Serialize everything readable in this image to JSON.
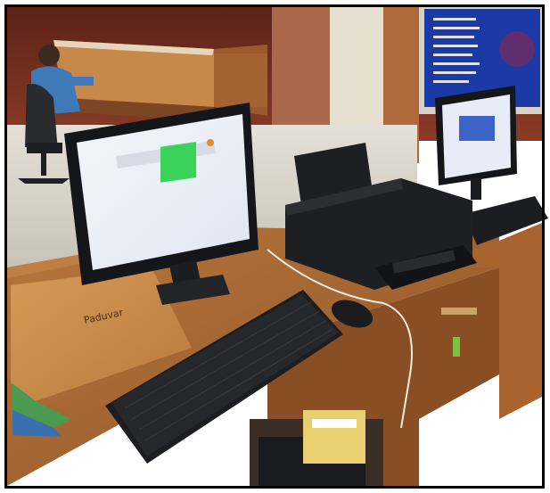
{
  "photo": {
    "logo_text": "Paduvar",
    "colors": {
      "wall": "#6a2a1e",
      "desk_wood": "#a0622f",
      "desk_dark": "#7a4522",
      "floor": "#d9d4cc",
      "screen_bg": "#eef2fa",
      "screen_blue": "#3d63c6",
      "green_button": "#3bd25a",
      "keyboard": "#1c1d20",
      "printer": "#1e1f22",
      "sign_blue": "#1c3aa6",
      "envelope": "#c98a4a",
      "border": "#000000"
    },
    "objects": [
      "left-monitor",
      "right-monitor",
      "printer",
      "keyboard",
      "right-keyboard",
      "mouse",
      "envelope",
      "office-chair",
      "seated-person",
      "back-counter",
      "blue-sign-board",
      "desk",
      "cpu-under-desk"
    ]
  }
}
